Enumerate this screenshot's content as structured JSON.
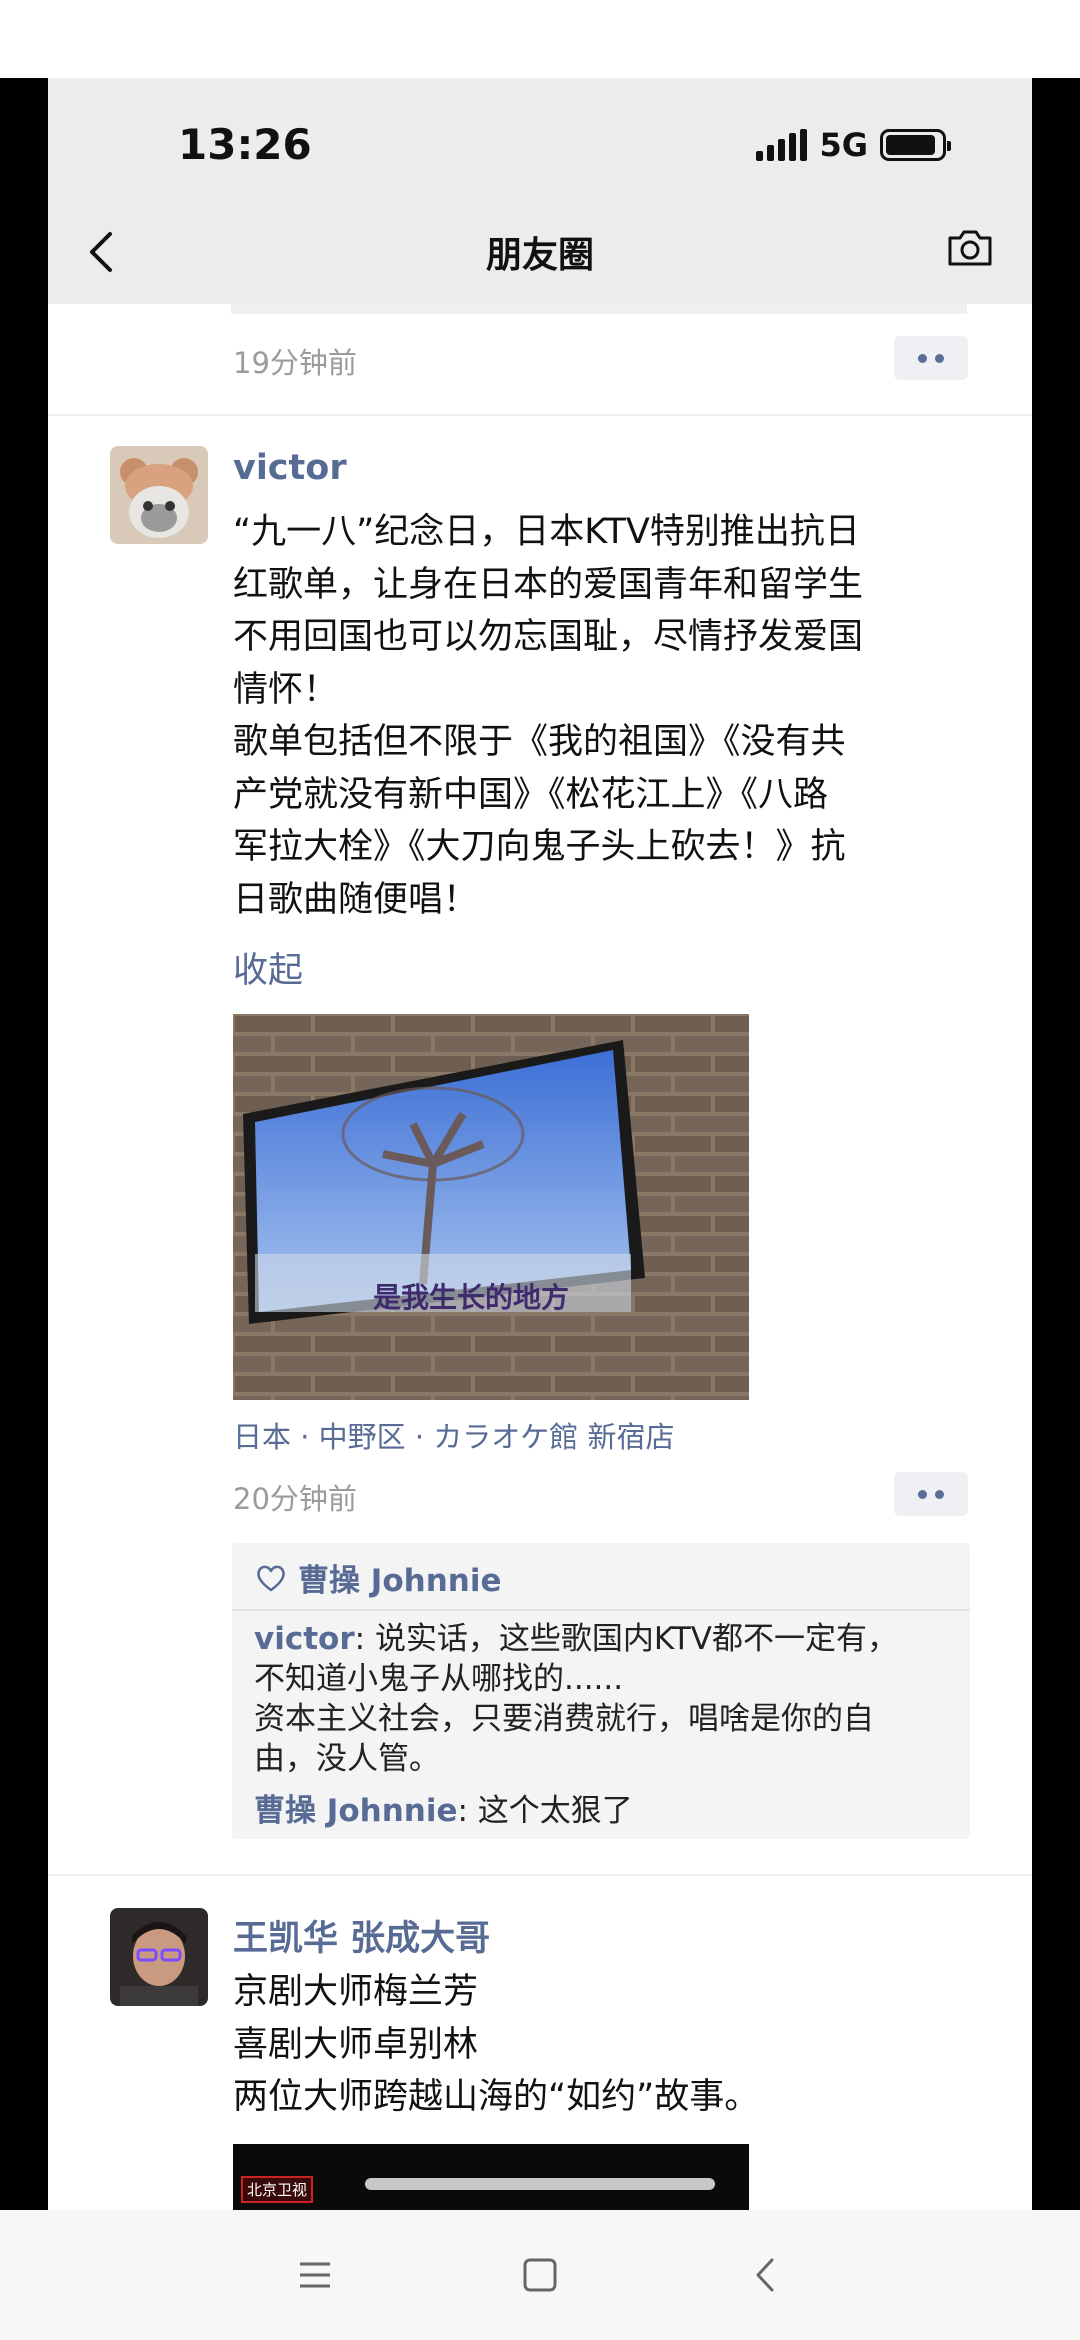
{
  "status_bar": {
    "time": "13:26",
    "network": "5G",
    "icons": [
      "signal-icon",
      "battery-icon"
    ]
  },
  "nav": {
    "title": "朋友圈",
    "back_icon": "chevron-left-icon",
    "camera_icon": "camera-icon"
  },
  "feed": {
    "prev_post_time": "19分钟前",
    "posts": [
      {
        "author": "victor",
        "text": "“九一八”纪念日，日本KTV特别推出抗日\n红歌单，让身在日本的爱国青年和留学生\n不用回国也可以勿忘国耻，尽情抒发爱国\n情怀！\n歌单包括但不限于《我的祖国》《没有共\n产党就没有新中国》《松花江上》《八路\n军拉大栓》《大刀向鬼子头上砍去！》抗\n日歌曲随便唱！",
        "collapse_label": "收起",
        "photo_caption": "是我生长的地方",
        "location": "日本 · 中野区 · カラオケ館 新宿店",
        "time": "20分钟前",
        "likes": "曹操 Johnnie",
        "comments": [
          {
            "name": "victor",
            "sep": ": ",
            "text": "说实话，这些歌国内KTV都不一定有，\n不知道小鬼子从哪找的......\n资本主义社会，只要消费就行，唱啥是你的自\n由，没人管。"
          },
          {
            "name": "曹操 Johnnie",
            "sep": ": ",
            "text": "这个太狠了"
          }
        ]
      },
      {
        "author": "王凯华 张成大哥",
        "text": "京剧大师梅兰芳\n喜剧大师卓别林\n两位大师跨越山海的“如约”故事。",
        "video_logo": "北京卫视"
      }
    ]
  },
  "system_nav": {
    "icons": [
      "menu-icon",
      "home-square-icon",
      "back-triangle-icon"
    ]
  }
}
